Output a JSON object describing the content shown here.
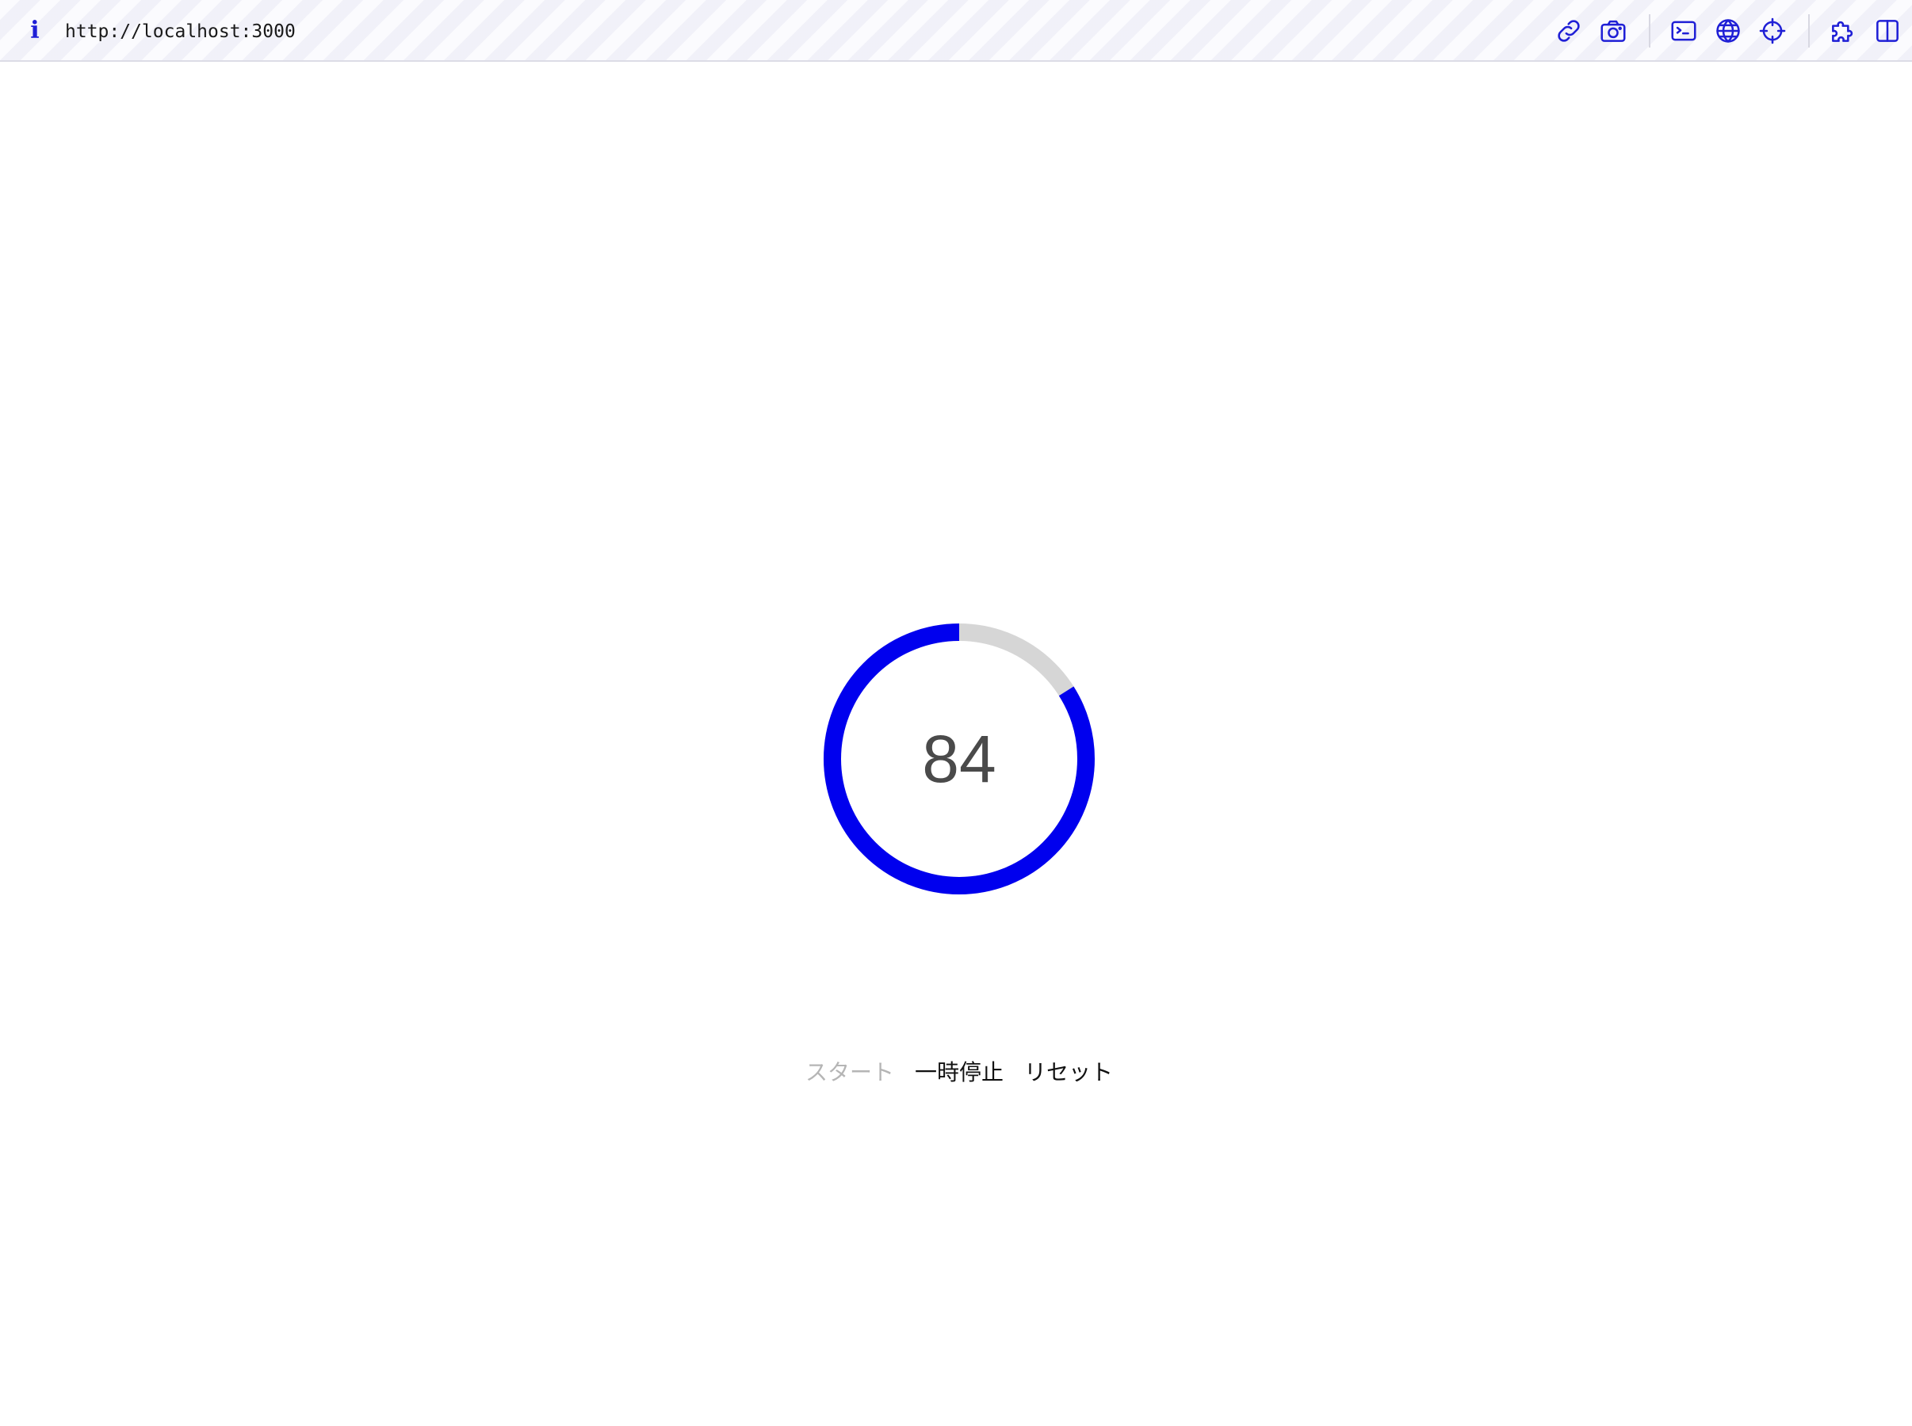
{
  "browser": {
    "url": "http://localhost:3000",
    "accent_color": "#1f1fd6",
    "icons": [
      "info-icon",
      "link-icon",
      "camera-icon",
      "terminal-icon",
      "globe-icon",
      "crosshair-icon",
      "puzzle-icon",
      "sidebar-icon"
    ]
  },
  "timer": {
    "value": "84",
    "progress_fraction": 0.84,
    "progress_color": "#0000ee",
    "track_color": "#d6d6d6"
  },
  "controls": {
    "start_label": "スタート",
    "start_disabled": true,
    "pause_label": "一時停止",
    "reset_label": "リセット"
  }
}
